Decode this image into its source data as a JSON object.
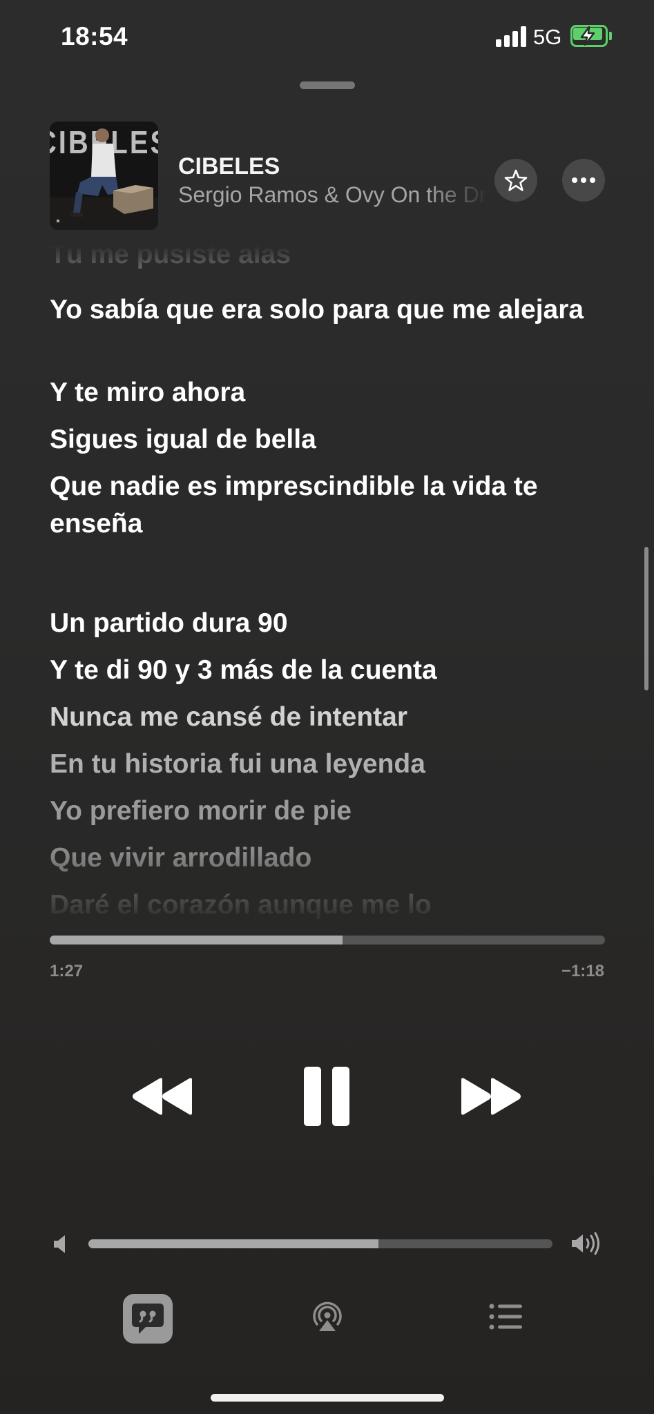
{
  "status_bar": {
    "time": "18:54",
    "network": "5G",
    "battery_color": "#5dd06b"
  },
  "now_playing": {
    "artwork_text": "CIBELES",
    "title": "CIBELES",
    "artist": "Sergio Ramos & Ovy On the Drums"
  },
  "lyrics": {
    "lines": [
      {
        "text": "Tú me pusiste alas"
      },
      {
        "text": "Yo sabía que era solo para que me alejara"
      },
      {
        "text": "Y te miro ahora"
      },
      {
        "text": "Sigues igual de bella"
      },
      {
        "text": "Que nadie es imprescindible la vida te enseña"
      },
      {
        "text": "Un partido dura 90"
      },
      {
        "text": "Y te di 90 y 3 más de la cuenta"
      },
      {
        "text": "Nunca me cansé de intentar"
      },
      {
        "text": "En tu historia fui una leyenda"
      },
      {
        "text": "Yo prefiero morir de pie"
      },
      {
        "text": "Que vivir arrodillado"
      },
      {
        "text": "Daré el corazón aunque me lo"
      }
    ]
  },
  "playback": {
    "elapsed": "1:27",
    "remaining": "−1:18",
    "progress_fraction": 0.527,
    "volume_fraction": 0.625
  },
  "icons": {
    "star": "star-icon",
    "more": "ellipsis-icon",
    "rewind": "rewind-icon",
    "pause": "pause-icon",
    "forward": "fast-forward-icon",
    "volume_low": "speaker-low-icon",
    "volume_high": "speaker-high-icon",
    "lyrics": "quote-bubble-icon",
    "airplay": "airplay-icon",
    "queue": "list-icon"
  }
}
